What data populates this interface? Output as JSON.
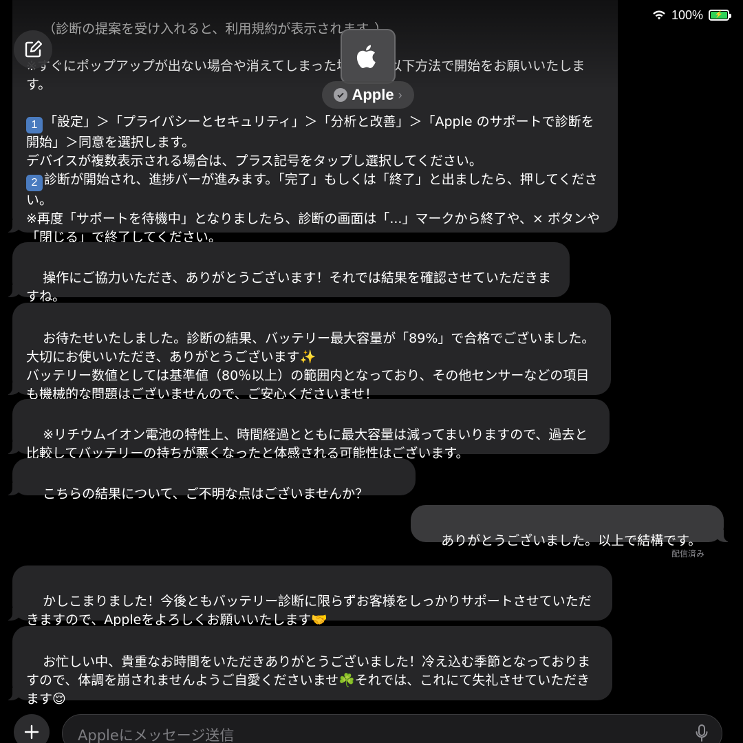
{
  "status_bar": {
    "battery_text": "100%",
    "icons": [
      "wifi-icon",
      "battery-charging-icon"
    ]
  },
  "header": {
    "contact_name": "Apple",
    "avatar_icon": "apple-logo-icon",
    "verified_icon": "verified-badge-icon"
  },
  "compose_icon": "compose-icon",
  "messages": [
    {
      "from": "agent",
      "text": "（診断の提案を受け入れると、利用規約が表示されます。）\n\n※すぐにポップアップが出ない場合や消えてしまった場合は、以下方法で開始をお願いいたします。\n\n"
    },
    {
      "from": "agent",
      "part": "step1",
      "text": "「設定」＞「プライバシーとセキュリティ」＞「分析と改善」＞「Apple のサポートで診断を開始」＞同意を選択します。\nデバイスが複数表示される場合は、プラス記号をタップし選択してください。"
    },
    {
      "from": "agent",
      "part": "step2",
      "text": "診断が開始され、進捗バーが進みます。「完了」もしくは「終了」と出ましたら、押してください。\n※再度「サポートを待機中」となりましたら、診断の画面は「...」マークから終了や、× ボタンや「閉じる」で終了してください。"
    },
    {
      "from": "agent",
      "text": "操作にご協力いただき、ありがとうございます！それでは結果を確認させていただきますね。"
    },
    {
      "from": "agent",
      "text": "お待たせいたしました。診断の結果、バッテリー最大容量が「89%」で合格でございました。大切にお使いいただき、ありがとうございます✨\nバッテリー数値としては基準値（80％以上）の範囲内となっており、その他センサーなどの項目も機械的な問題はございませんので、ご安心くださいませ！"
    },
    {
      "from": "agent",
      "text": "※リチウムイオン電池の特性上、時間経過とともに最大容量は減ってまいりますので、過去と比較してバッテリーの持ちが悪くなったと体感される可能性はございます。"
    },
    {
      "from": "agent",
      "text": "こちらの結果について、ご不明な点はございませんか？"
    },
    {
      "from": "user",
      "text": "ありがとうございました。以上で結構です。"
    },
    {
      "from": "agent",
      "text": "かしこまりました！今後ともバッテリー診断に限らずお客様をしっかりサポートさせていただきますので、Appleをよろしくお願いいたします🤝"
    },
    {
      "from": "agent",
      "text": "お忙しい中、貴重なお時間をいただきありがとうございました！冷え込む季節となっておりますので、体調を崩されませんようご自愛くださいませ☘️それでは、これにて失礼させていただきます😌"
    }
  ],
  "step_badges": [
    "1",
    "2"
  ],
  "delivered_label": "配信済み",
  "input": {
    "placeholder": "Appleにメッセージ送信",
    "plus_icon": "plus-icon",
    "mic_icon": "microphone-icon"
  }
}
